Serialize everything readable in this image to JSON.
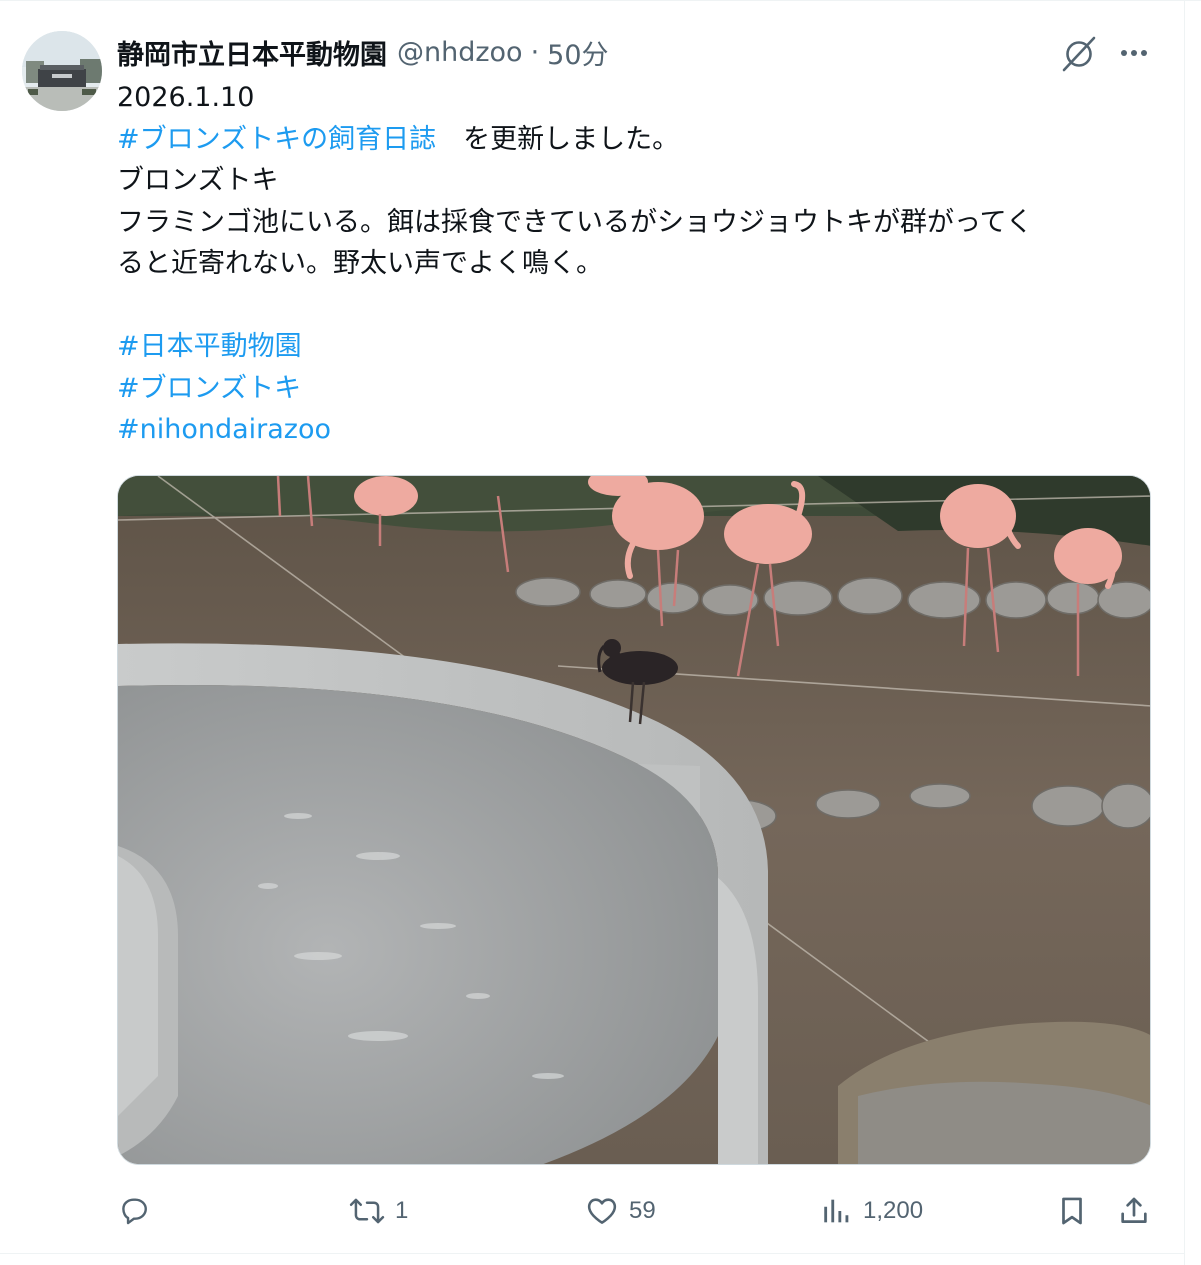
{
  "author": {
    "display_name": "静岡市立日本平動物園",
    "handle": "@nhdzoo",
    "separator": "·",
    "timestamp": "50分"
  },
  "header_icons": [
    "grok-icon",
    "more-icon"
  ],
  "post": {
    "date_line": "2026.1.10",
    "diary_hashtag": "#ブロンズトキの飼育日誌",
    "diary_suffix": "　を更新しました。",
    "species_line": "ブロンズトキ",
    "note_line_1": "フラミンゴ池にいる。餌は採食できているがショウジョウトキが群がってく",
    "note_line_2": "ると近寄れない。野太い声でよく鳴く。",
    "hashtags": [
      "#日本平動物園",
      "#ブロンズトキ",
      "#nihondairazoo"
    ]
  },
  "media": {
    "icon": "photo",
    "colors": {
      "ground": "#6e5f50",
      "concrete": "#a3a5a6",
      "rim": "#cfd1d1",
      "flamingo": "#eeaaa0",
      "ibis": "#2a2426",
      "foliage": "#3e4a38"
    }
  },
  "actions": {
    "reply": {
      "icon": "reply-icon",
      "count": ""
    },
    "repost": {
      "icon": "repost-icon",
      "count": "1"
    },
    "like": {
      "icon": "heart-icon",
      "count": "59"
    },
    "views": {
      "icon": "views-icon",
      "count": "1,200"
    },
    "bookmark": {
      "icon": "bookmark-icon"
    },
    "share": {
      "icon": "share-icon"
    }
  },
  "colors": {
    "text": "#0f1419",
    "secondary": "#536471",
    "link": "#1d9bf0",
    "border": "#cfd9de"
  }
}
